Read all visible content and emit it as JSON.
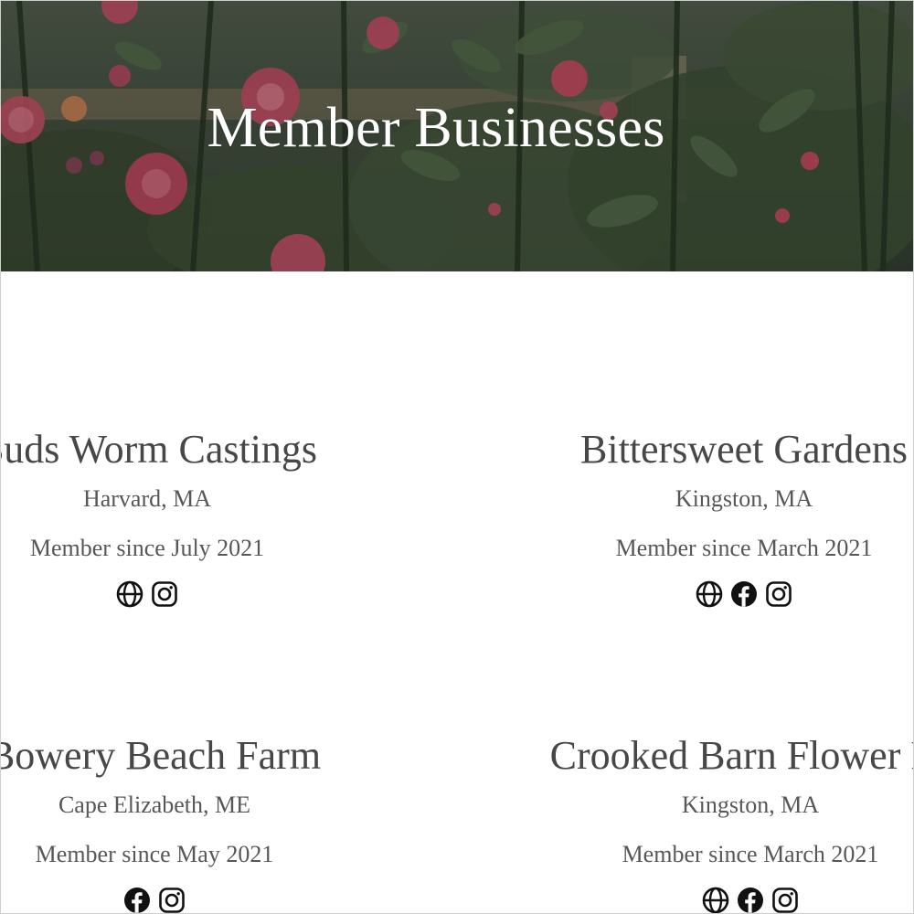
{
  "hero": {
    "title": "Member Businesses"
  },
  "businesses": [
    {
      "name": "Buds Worm Castings",
      "location": "Harvard, MA",
      "member_since": "Member since July 2021",
      "links": [
        "website-icon",
        "instagram-icon"
      ]
    },
    {
      "name": "Bittersweet Gardens",
      "location": "Kingston, MA",
      "member_since": "Member since March 2021",
      "links": [
        "website-icon",
        "facebook-icon",
        "instagram-icon"
      ]
    },
    {
      "name": "Bowery Beach Farm",
      "location": "Cape Elizabeth, ME",
      "member_since": "Member since May 2021",
      "links": [
        "facebook-icon",
        "instagram-icon"
      ]
    },
    {
      "name": "Crooked Barn Flower Fa",
      "location": "Kingston, MA",
      "member_since": "Member since March 2021",
      "links": [
        "website-icon",
        "facebook-icon",
        "instagram-icon"
      ]
    }
  ],
  "colors": {
    "text": "#474747",
    "icon": "#111111",
    "hero_overlay": "#3a4438"
  }
}
